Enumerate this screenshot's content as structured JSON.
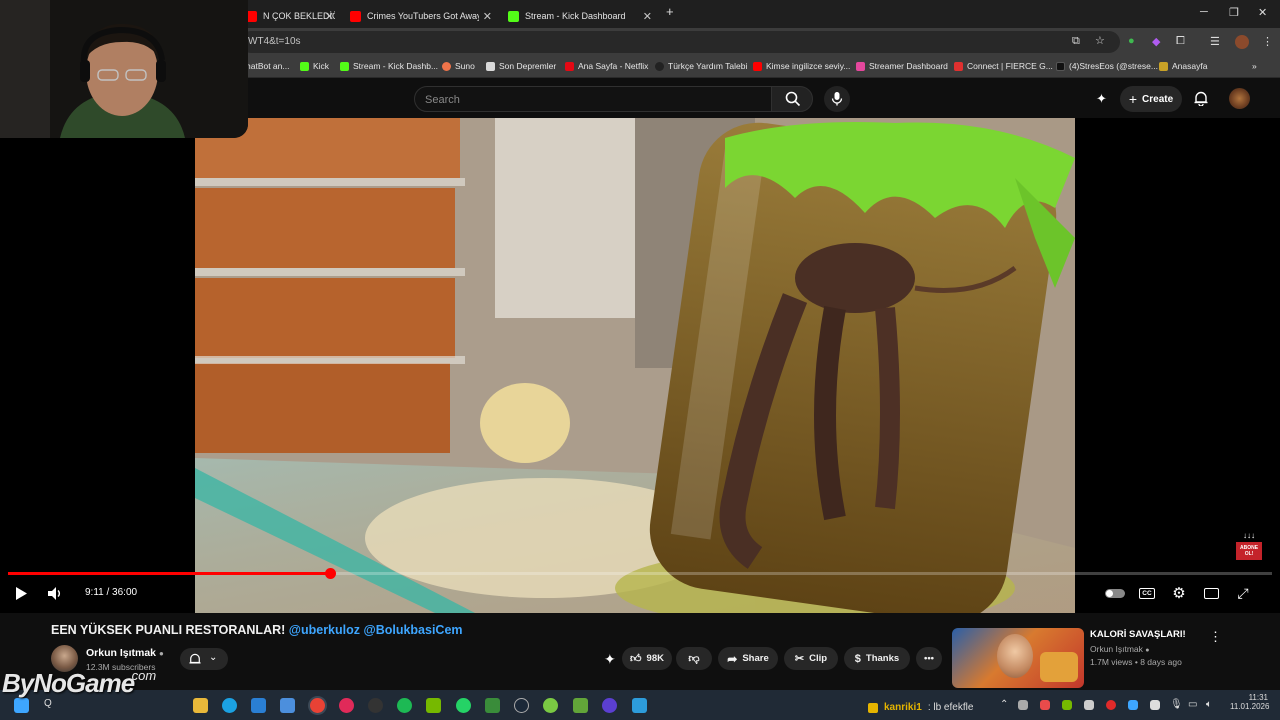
{
  "browser": {
    "tabs": [
      {
        "label": "N ÇOK BEKLEDİĞİM",
        "color": "#ff0000"
      },
      {
        "label": "Crimes YouTubers Got Away W",
        "color": "#ff0000"
      },
      {
        "label": "Stream - Kick Dashboard",
        "color": "#53fc18"
      }
    ],
    "new_tab": "+",
    "url": "WT4&t=10s",
    "bookmarks": [
      {
        "label": "hatBot an...",
        "color": "#888888"
      },
      {
        "label": "Kick",
        "color": "#53fc18"
      },
      {
        "label": "Stream - Kick Dashb...",
        "color": "#53fc18"
      },
      {
        "label": "Suno",
        "color": "#f0744a"
      },
      {
        "label": "Son Depremler",
        "color": "#d9d9d9"
      },
      {
        "label": "Ana Sayfa - Netflix",
        "color": "#e50914"
      },
      {
        "label": "Türkçe Yardım Talebi",
        "color": "#222222"
      },
      {
        "label": "Kimse ingilizce seviy...",
        "color": "#ff0000"
      },
      {
        "label": "Streamer Dashboard",
        "color": "#e5479d"
      },
      {
        "label": "Connect | FIERCE G...",
        "color": "#e0302f"
      },
      {
        "label": "(4)StresEos (@strese...",
        "color": "#111111"
      },
      {
        "label": "Anasayfa",
        "color": "#c9a227"
      }
    ]
  },
  "youtube": {
    "search_placeholder": "Search",
    "create_label": "Create",
    "player": {
      "current_time": "9:11",
      "duration": "36:00",
      "progress": 0.255,
      "time_display": "9:11 / 36:00",
      "subscribe_badge": "ABONE OL!"
    },
    "video": {
      "title_main": "EEN YÜKSEK PUANLI RESTORANLAR!",
      "title_tag1": "@uberkuloz",
      "title_tag2": "@BolukbasiCem",
      "channel": "Orkun Işıtmak",
      "subscribers": "12.3M subscribers",
      "likes": "98K",
      "share_label": "Share",
      "clip_label": "Clip",
      "thanks_label": "Thanks",
      "more_label": "•••"
    },
    "recommended": {
      "title": "KALORİ SAVAŞLARI!",
      "channel": "Orkun Işıtmak",
      "meta": "1.7M views • 8 days ago"
    }
  },
  "taskbar": {
    "search_hint": "Q",
    "time": "11:31",
    "date": "11.01.2026"
  },
  "watermark": {
    "main": "ByNoGame",
    "suffix": ".com"
  },
  "chat_overlay": {
    "user": "kanriki1",
    "message": ": lb efekfle"
  }
}
